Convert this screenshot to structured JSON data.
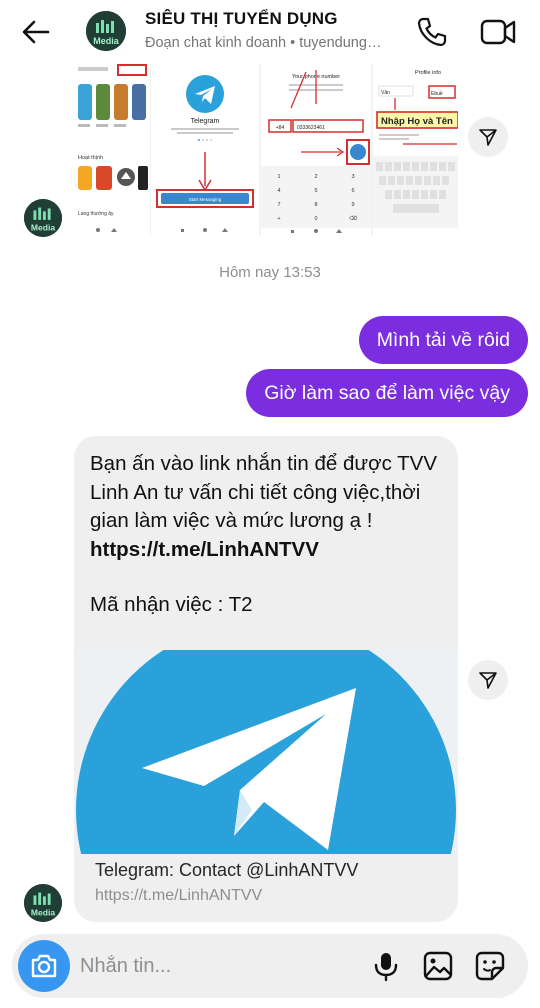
{
  "header": {
    "title": "SIÊU THỊ TUYỂN DỤNG",
    "subtitle": "Đoạn chat kinh doanh • tuyendung…",
    "avatar_text": "Media"
  },
  "screenshots": {
    "shot1": {
      "section1": "Hoạt thịnh",
      "section2": "Lang thường ây"
    },
    "shot2": {
      "app_name": "Telegram",
      "tagline": "The world's fastest messaging app. It is free and secure.",
      "button": "Start Messaging"
    },
    "shot3": {
      "title": "Your phone number",
      "country_code": "+84",
      "phone": "0333623461",
      "keys": [
        "1",
        "2",
        "3",
        "4",
        "5",
        "6",
        "7",
        "8",
        "9",
        "+",
        "0",
        "⌫"
      ]
    },
    "shot4": {
      "title": "Profile info",
      "first": "Văn",
      "last": "Ebuề",
      "overlay": "Nhập Họ và Tên"
    }
  },
  "messages": {
    "timestamp": "Hôm nay 13:53",
    "outgoing": [
      "Mình tải về rôid",
      "Giờ làm sao để làm việc vậy"
    ],
    "incoming": {
      "lines": [
        "Bạn ấn vào link nhắn tin để được TVV Linh An tư vấn chi tiết công việc,thời gian làm việc và mức lương ạ !"
      ],
      "link": "https://t.me/LinhANTVV",
      "code": "Mã nhận việc : T2",
      "card_title": "Telegram: Contact @LinhANTVV",
      "card_url": "https://t.me/LinhANTVV"
    }
  },
  "composer": {
    "placeholder": "Nhắn tin..."
  },
  "colors": {
    "accent": "#7b2de0",
    "camera": "#3797f0",
    "telegram": "#2aa1da"
  }
}
